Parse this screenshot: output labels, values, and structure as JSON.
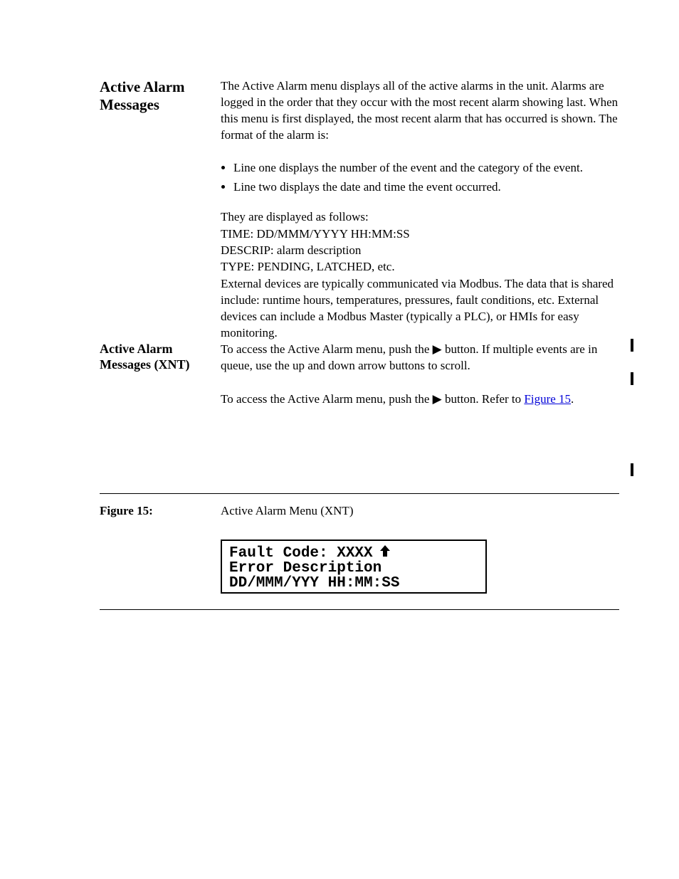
{
  "heading1": "Active Alarm Messages",
  "para1": "The Active Alarm menu displays all of the active alarms in the unit. Alarms are logged in the order that they occur with the most recent alarm showing last. When this menu is first displayed, the most recent alarm that has occurred is shown. The format of the alarm is:",
  "list": [
    "Line one displays the number of the event and the category of the event.",
    "Line two displays the date and time the event occurred."
  ],
  "para2": "They are displayed as follows:",
  "codes": [
    "TIME: DD/MMM/YYYY HH:MM:SS",
    "DESCRIP: alarm description",
    "TYPE: PENDING, LATCHED, etc."
  ],
  "para3": "External devices are typically communicated via Modbus. The data that is shared include: runtime hours, temperatures, pressures, fault conditions, etc. External devices can include a Modbus Master (typically a PLC), or HMIs for easy monitoring.",
  "heading2_left": "Active Alarm Messages (XNT)",
  "para4a": "To access the Active Alarm menu, push the ",
  "para4a_arrow": "▶",
  "para4a_cont": " button. If multiple events are in queue, use the up and down arrow buttons to scroll.",
  "para5a": "To access the Active Alarm menu, push the ",
  "para5a_arrow": "▶",
  "para5a_cont": " button. Refer to ",
  "para5_link": "Figure 15",
  "para5_dot": ".",
  "figure_caption_left": "Figure 15:",
  "figure_caption_right": "Active Alarm Menu (XNT)",
  "lcd": {
    "line1_pre": "Fault Code: XXXX",
    "line1_arrow": "⬆",
    "line2": "Error Description",
    "line3": "DD/MMM/YYY HH:MM:SS"
  }
}
